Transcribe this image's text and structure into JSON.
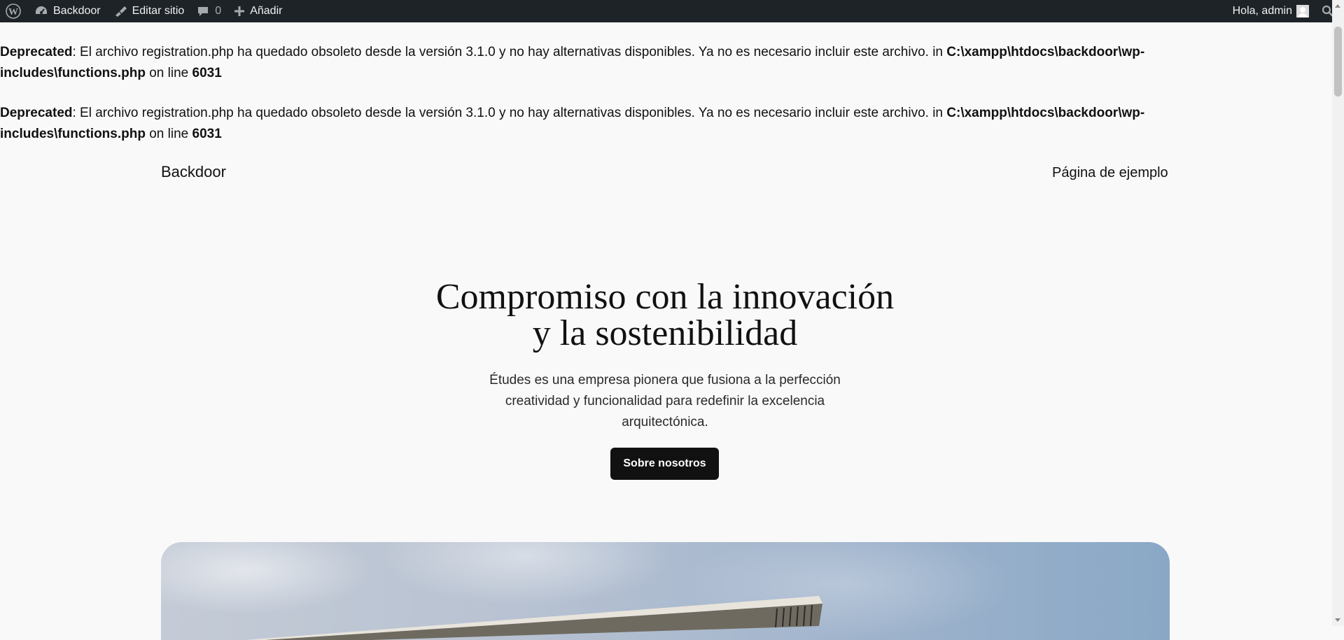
{
  "adminbar": {
    "site_name": "Backdoor",
    "edit_site": "Editar sitio",
    "comments_count": "0",
    "add_new": "Añadir",
    "greeting": "Hola, admin"
  },
  "notices": [
    {
      "label": "Deprecated",
      "message": ": El archivo registration.php ha quedado obsoleto desde la versión 3.1.0 y no hay alternativas disponibles. Ya no es necesario incluir este archivo. in ",
      "path": "C:\\xampp\\htdocs\\backdoor\\wp-includes\\functions.php",
      "line_text": " on line ",
      "line": "6031"
    },
    {
      "label": "Deprecated",
      "message": ": El archivo registration.php ha quedado obsoleto desde la versión 3.1.0 y no hay alternativas disponibles. Ya no es necesario incluir este archivo. in ",
      "path": "C:\\xampp\\htdocs\\backdoor\\wp-includes\\functions.php",
      "line_text": " on line ",
      "line": "6031"
    }
  ],
  "header": {
    "site_title": "Backdoor",
    "nav_link": "Página de ejemplo"
  },
  "hero": {
    "title_line1": "Compromiso con la innovación",
    "title_line2": "y la sostenibilidad",
    "text": "Études es una empresa pionera que fusiona a la perfección creatividad y funcionalidad para redefinir la excelencia arquitectónica.",
    "button": "Sobre nosotros"
  }
}
